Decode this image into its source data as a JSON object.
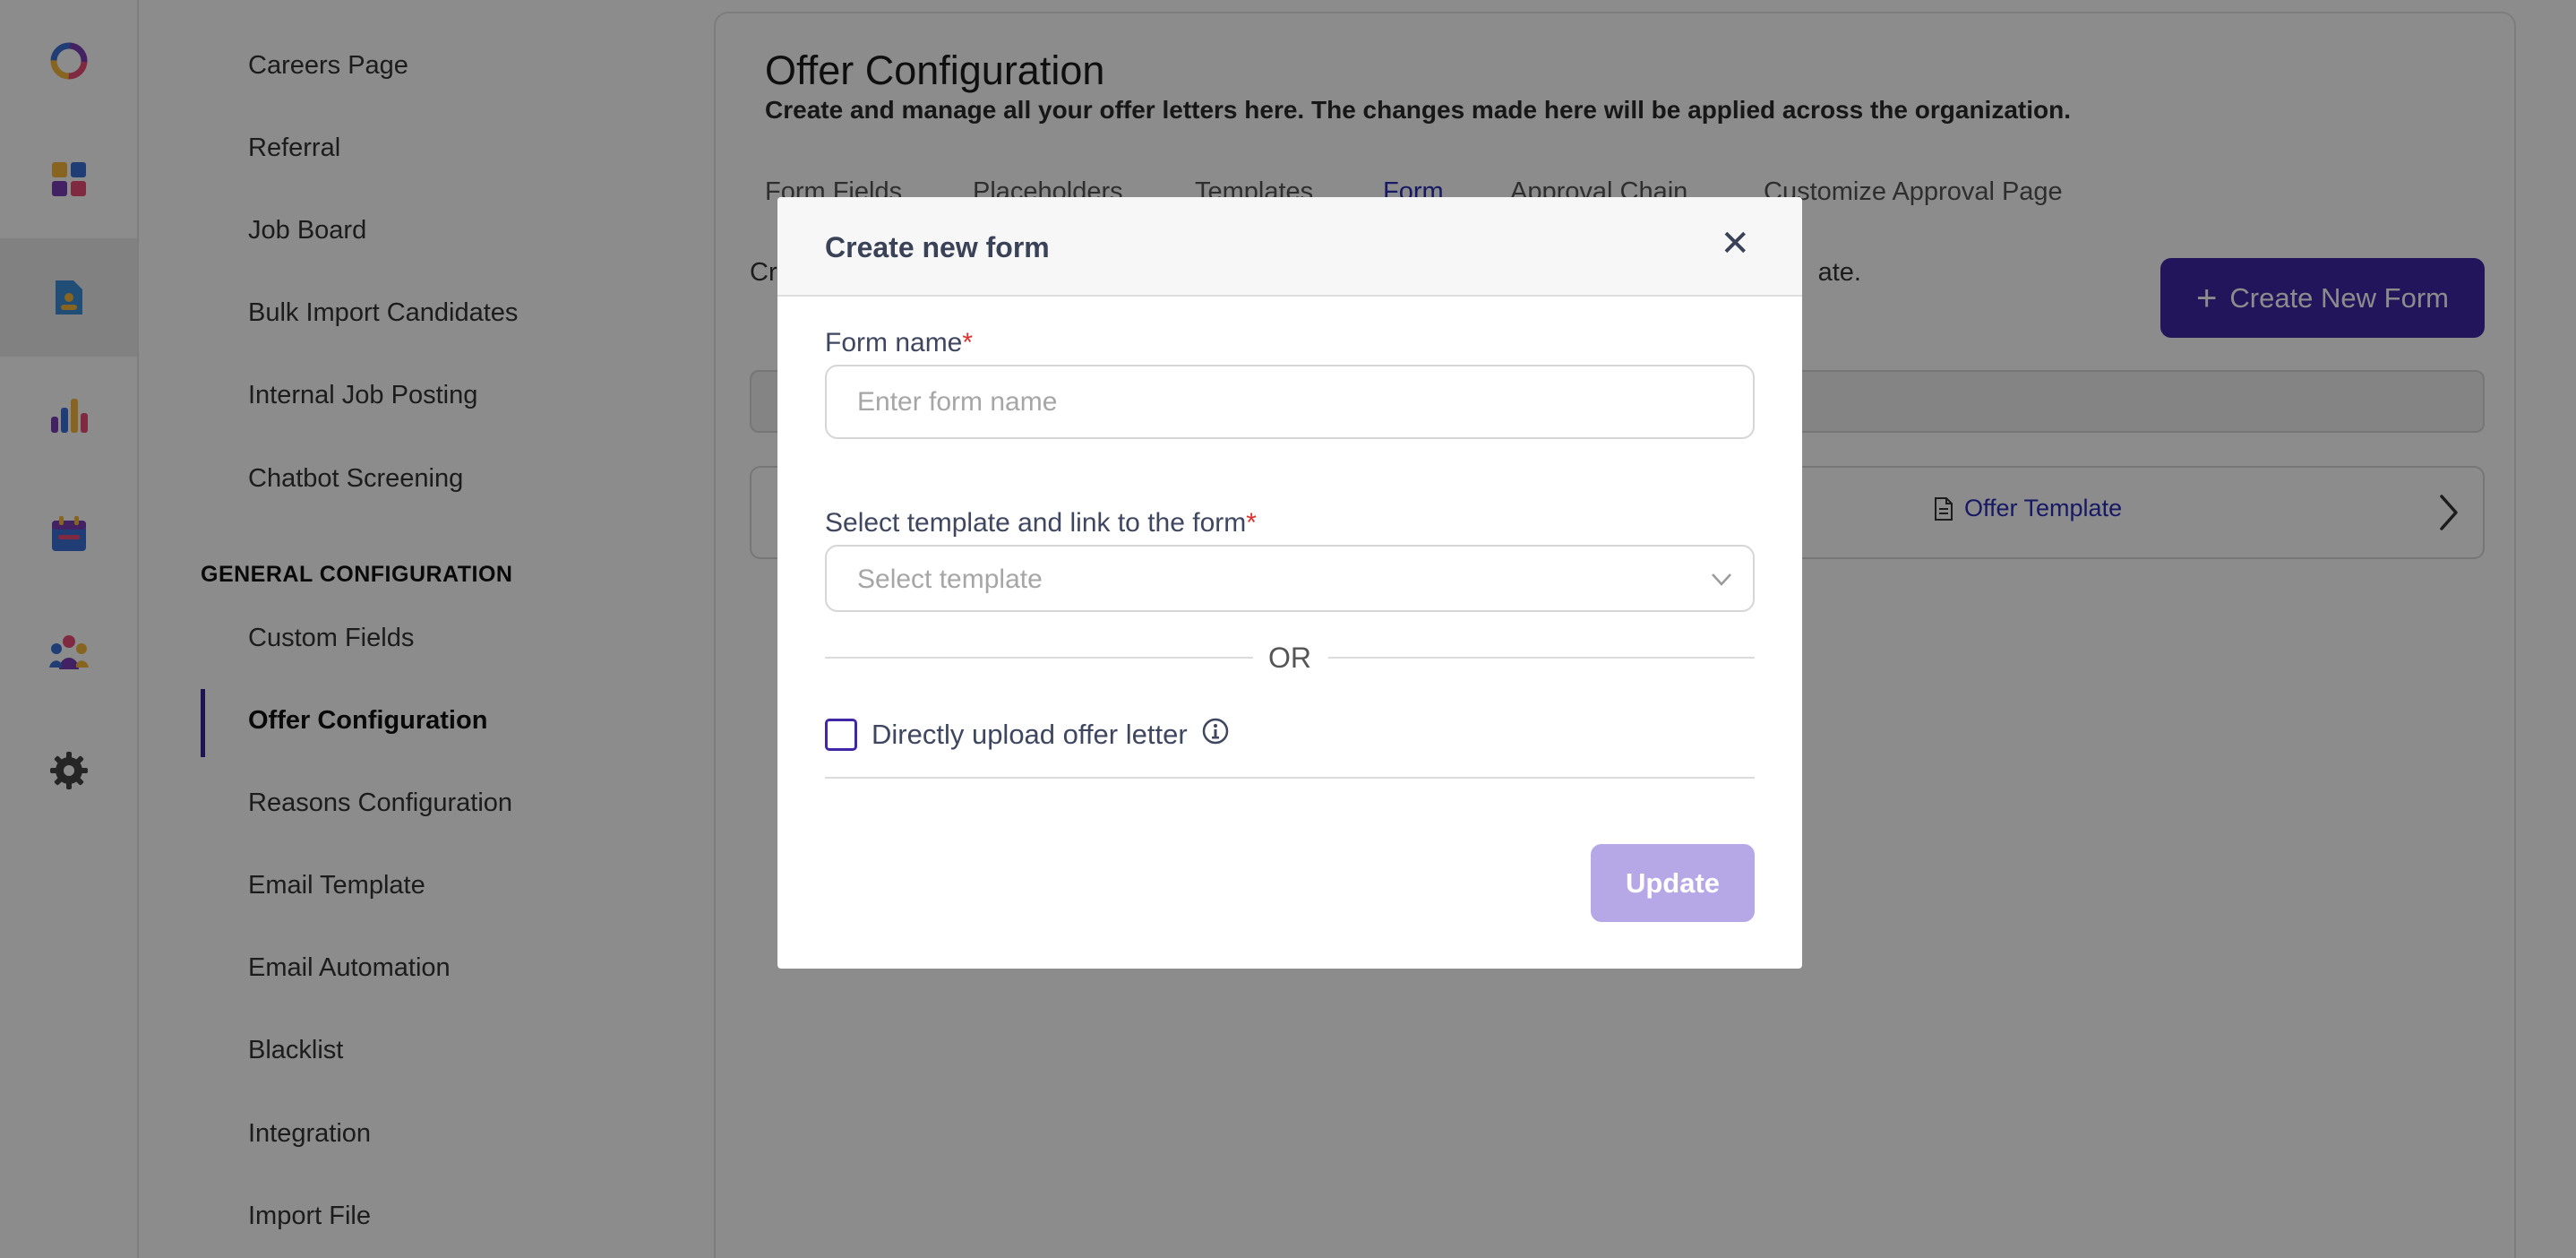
{
  "sidebar": {
    "items": [
      {
        "label": "Careers Page"
      },
      {
        "label": "Referral"
      },
      {
        "label": "Job Board"
      },
      {
        "label": "Bulk Import Candidates"
      },
      {
        "label": "Internal Job Posting"
      },
      {
        "label": "Chatbot Screening"
      }
    ],
    "general_heading": "GENERAL CONFIGURATION",
    "general_items": [
      {
        "label": "Custom Fields"
      },
      {
        "label": "Offer Configuration"
      },
      {
        "label": "Reasons Configuration"
      },
      {
        "label": "Email Template"
      },
      {
        "label": "Email Automation"
      },
      {
        "label": "Blacklist"
      },
      {
        "label": "Integration"
      },
      {
        "label": "Import File"
      }
    ]
  },
  "main": {
    "title": "Offer Configuration",
    "subtitle": "Create and manage all your offer letters here. The changes made here will be applied across the organization.",
    "tabs": [
      {
        "label": "Form Fields"
      },
      {
        "label": "Placeholders"
      },
      {
        "label": "Templates"
      },
      {
        "label": "Form"
      },
      {
        "label": "Approval Chain"
      },
      {
        "label": "Customize Approval Page"
      }
    ],
    "description_visible_start": "Cr",
    "description_visible_end": "ate.",
    "create_button_label": "Create New Form",
    "row_template_label": "Offer Template"
  },
  "modal": {
    "title": "Create new form",
    "form_name_label": "Form name",
    "form_name_placeholder": "Enter form name",
    "form_name_value": "",
    "template_label": "Select template and link to the form",
    "template_placeholder": "Select template",
    "or_text": "OR",
    "upload_label": "Directly upload offer letter",
    "upload_checked": false,
    "update_label": "Update"
  },
  "colors": {
    "accent": "#4127a8",
    "tab_active": "#2a2fb8",
    "required": "#e03131",
    "update_disabled": "#b6a8e6"
  },
  "icons": {
    "rail": [
      "logo-icon",
      "dashboard-icon",
      "jobs-icon",
      "analytics-icon",
      "calendar-icon",
      "team-icon",
      "settings-icon"
    ]
  }
}
